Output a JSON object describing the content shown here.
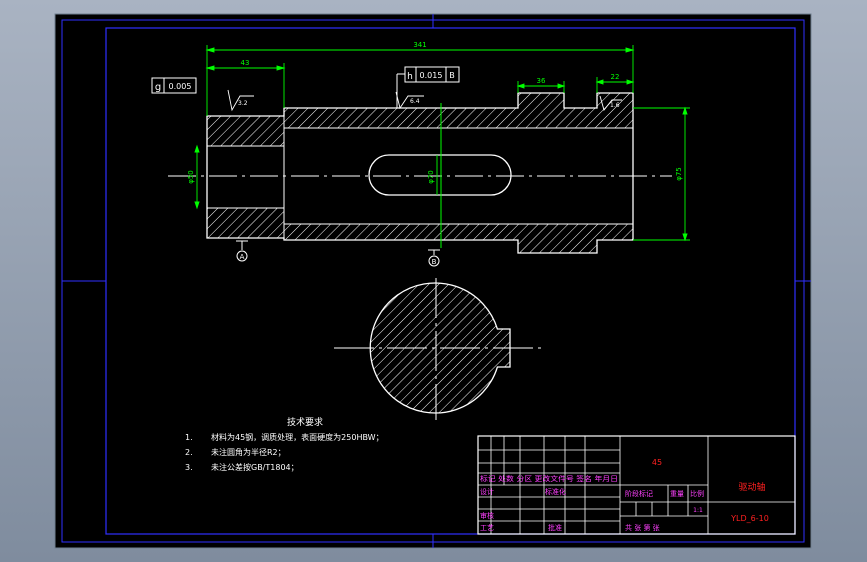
{
  "drawing": {
    "dims": {
      "overall_length": "341",
      "left_step": "43",
      "keyway_width": "36",
      "right_step": "22"
    },
    "tolerance_frames": {
      "flatness": {
        "symbol": "g",
        "value": "0.005"
      },
      "runout": {
        "symbol": "h",
        "value": "0.015",
        "datum": "B"
      }
    },
    "roughness": {
      "r1": "3.2",
      "r2": "6.4",
      "r3": "1.6"
    },
    "datum_labels": {
      "a": "A",
      "b": "B"
    },
    "diameter_labels": {
      "left": "φ50",
      "center": "φ70",
      "right": "φ75"
    }
  },
  "tech_requirements": {
    "title": "技术要求",
    "items": [
      {
        "num": "1.",
        "text": "材料为45钢，调质处理，表面硬度为250HBW；"
      },
      {
        "num": "2.",
        "text": "未注圆角为半径R2；"
      },
      {
        "num": "3.",
        "text": "未注公差按GB/T1804；"
      }
    ]
  },
  "title_block": {
    "material": "45",
    "part_name": "驱动轴",
    "drawing_no": "YLD_6-10",
    "row_headers": "标记 处数 分区 更改文件号 签名 年月日",
    "design": "设计",
    "standardize": "标准化",
    "review": "审核",
    "process": "工艺",
    "approve": "批准",
    "stage_mark": "阶段标记",
    "weight": "重量",
    "scale_label": "比例",
    "scale_value": "1:1",
    "sheets": "共  张  第  张"
  },
  "colors": {
    "background": "#000000",
    "outline": "#ffffff",
    "dimension": "#00ff00",
    "border": "#0000ff",
    "title_text": "#ff00ff",
    "name_text": "#ff0000"
  }
}
